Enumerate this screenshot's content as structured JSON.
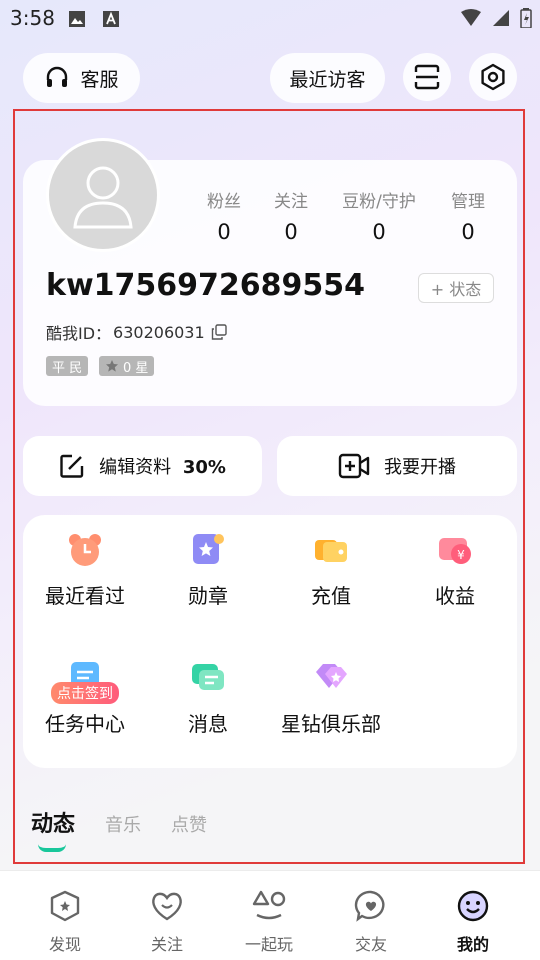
{
  "status_bar": {
    "time": "3:58"
  },
  "header": {
    "service_label": "客服",
    "recent_visitors_label": "最近访客"
  },
  "profile": {
    "stats": [
      {
        "label": "粉丝",
        "value": "0"
      },
      {
        "label": "关注",
        "value": "0"
      },
      {
        "label": "豆粉/守护",
        "value": "0"
      },
      {
        "label": "管理",
        "value": "0"
      }
    ],
    "username": "kw1756972689554",
    "status_button": "+ 状态",
    "id_label": "酷我ID：",
    "id_value": "630206031",
    "badges": {
      "rank": "平 民",
      "stars": "0 星"
    }
  },
  "actions": {
    "edit_label": "编辑资料",
    "edit_progress": "30%",
    "live_label": "我要开播"
  },
  "grid": {
    "items": [
      {
        "label": "最近看过",
        "icon": "alarm-clock-icon"
      },
      {
        "label": "勋章",
        "icon": "medal-icon"
      },
      {
        "label": "充值",
        "icon": "wallet-icon"
      },
      {
        "label": "收益",
        "icon": "earnings-icon"
      },
      {
        "label": "任务中心",
        "icon": "task-icon",
        "tag": "点击签到"
      },
      {
        "label": "消息",
        "icon": "message-icon"
      },
      {
        "label": "星钻俱乐部",
        "icon": "diamond-heart-icon"
      }
    ]
  },
  "tabs": [
    "动态",
    "音乐",
    "点赞"
  ],
  "bottom_nav": [
    {
      "label": "发现",
      "icon": "discover-icon"
    },
    {
      "label": "关注",
      "icon": "heart-icon"
    },
    {
      "label": "一起玩",
      "icon": "play-together-icon"
    },
    {
      "label": "交友",
      "icon": "chat-heart-icon"
    },
    {
      "label": "我的",
      "icon": "smiley-icon"
    }
  ],
  "colors": {
    "accent": "#19c79b",
    "highlight_border": "#e03a3a",
    "checkin_tag": "#ff5b7b"
  }
}
